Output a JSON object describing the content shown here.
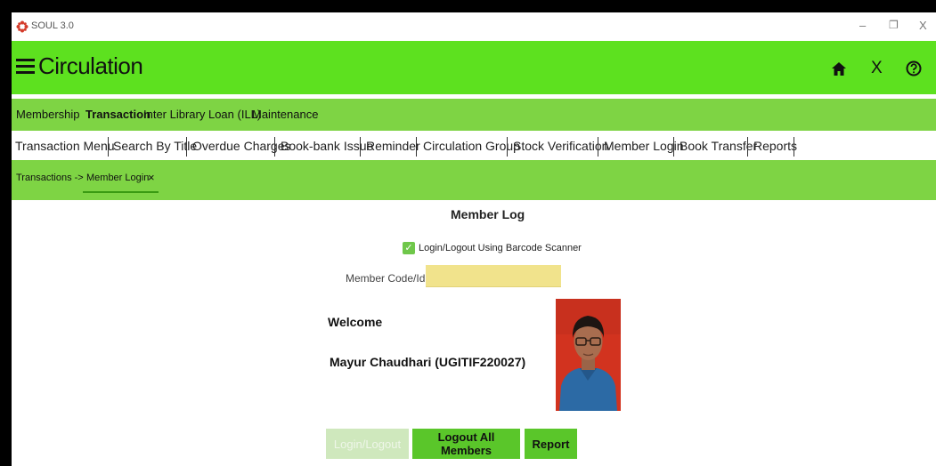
{
  "window": {
    "title": "SOUL 3.0",
    "controls": [
      "–",
      "❐",
      "X"
    ]
  },
  "header": {
    "title": "Circulation",
    "close_symbol": "X"
  },
  "menubar": {
    "items": [
      "Membership",
      "Transaction",
      "Inter Library Loan (ILL)",
      "Maintenance"
    ],
    "active": "Transaction"
  },
  "tabs": [
    "Transaction Menu",
    "Search By Title",
    "Overdue Charges",
    "Book-bank Issue",
    "Reminder",
    "Circulation Group",
    "Stock Verification",
    "Member Login",
    "Book Transfer",
    "Reports"
  ],
  "breadcrumb": {
    "parent": "Transactions ->",
    "current": "Member Login",
    "close": "×"
  },
  "member_log": {
    "title": "Member Log",
    "barcode_checkbox_label": "Login/Logout Using Barcode Scanner",
    "barcode_checked": true,
    "member_code_label": "Member Code/Id",
    "member_code_value": "",
    "welcome_label": "Welcome",
    "member_name": "Mayur Chaudhari (UGITIF220027)"
  },
  "buttons": {
    "login_logout": "Login/Logout",
    "logout_all": "Logout All Members",
    "report": "Report"
  },
  "colors": {
    "header_green": "#5de11f",
    "bar_green": "#7ed444",
    "input_yellow": "#f1e38c",
    "button_green": "#5ac62a"
  }
}
